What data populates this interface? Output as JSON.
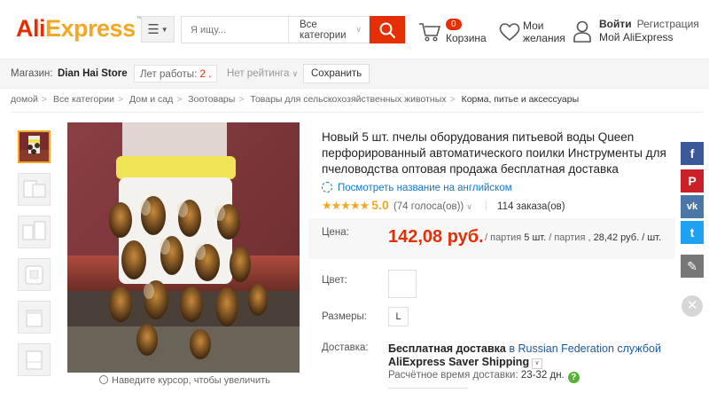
{
  "header": {
    "logo_part1": "Ali",
    "logo_part2": "Express",
    "logo_mark": "™",
    "menu_icon": "hamburger-icon",
    "search_placeholder": "Я ищу...",
    "search_category": "Все категории",
    "search_icon": "search-icon",
    "cart_count": "0",
    "cart_label": "Корзина",
    "wishlist_line1": "Мои",
    "wishlist_line2": "желания",
    "login_label": "Войти",
    "register_label": "Регистрация",
    "account_label": "Мой AliExpress",
    "brand_color": "#e62e04"
  },
  "store": {
    "label": "Магазин:",
    "name": "Dian Hai Store",
    "years_label": "Лет работы:",
    "years_value": "2 .",
    "rating_label": "Нет рейтинга",
    "save_label": "Сохранить"
  },
  "breadcrumb": [
    "домой",
    "Все категории",
    "Дом и сад",
    "Зоотовары",
    "Товары для сельскохозяйственных животных",
    "Корма, питье и аксессуары"
  ],
  "gallery": {
    "thumb_count": 6,
    "active_index": 0,
    "zoom_hint": "Наведите курсор, чтобы увеличить"
  },
  "product": {
    "title": "Новый 5 шт. пчелы оборудования питьевой воды Queen перфорированный автоматического поилки Инструменты для пчеловодства оптовая продажа бесплатная доставка",
    "translate_label": "Посмотреть название на английском",
    "rating_stars": "★★★★★",
    "rating_score": "5.0",
    "votes": "(74 голоса(ов))",
    "orders": "114 заказа(ов)",
    "price_label": "Цена:",
    "price": "142,08 руб.",
    "price_unit_prefix": "/ партия",
    "price_unit_qty": "5 шт.",
    "price_unit_suffix": "/ партия ,",
    "price_per_piece": "28,42 руб. / шт.",
    "color_label": "Цвет:",
    "size_label": "Размеры:",
    "size_value": "L",
    "shipping_label": "Доставка:",
    "shipping_bold": "Бесплатная доставка",
    "shipping_in": "в",
    "shipping_country": "Russian Federation",
    "shipping_service_prefix": "службой",
    "shipping_service": "AliExpress Saver Shipping",
    "eta_label": "Расчётное время доставки:",
    "eta_value": "23-32 дн.",
    "eta_help_icon": "question-icon"
  },
  "social": [
    {
      "name": "facebook",
      "glyph": "f",
      "color": "#3b5998"
    },
    {
      "name": "pinterest",
      "glyph": "P",
      "color": "#cb2027"
    },
    {
      "name": "vk",
      "glyph": "vk",
      "color": "#4a76a8"
    },
    {
      "name": "twitter",
      "glyph": "t",
      "color": "#1da1f2"
    },
    {
      "name": "edit",
      "glyph": "✎",
      "color": "#777777"
    }
  ]
}
